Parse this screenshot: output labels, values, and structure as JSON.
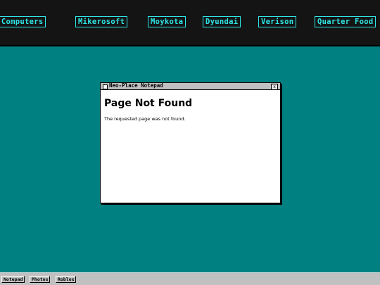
{
  "brand_bar": {
    "links": [
      {
        "label": "ar Computers"
      },
      {
        "label": "Mikerosoft"
      },
      {
        "label": "Moykota"
      },
      {
        "label": "Dyundai"
      },
      {
        "label": "Verison"
      },
      {
        "label": "Quarter Food"
      }
    ]
  },
  "window": {
    "title": "Neo-Place Notepad",
    "close_label": "x",
    "heading": "Page Not Found",
    "message": "The requested page was not found."
  },
  "taskbar": {
    "items": [
      {
        "label": "Notepad"
      },
      {
        "label": "Photos"
      },
      {
        "label": "Roblox"
      }
    ]
  },
  "colors": {
    "desktop": "#008080",
    "topbar": "#141414",
    "brand_accent": "#2fe6e6",
    "chrome": "#c0c0c0"
  }
}
